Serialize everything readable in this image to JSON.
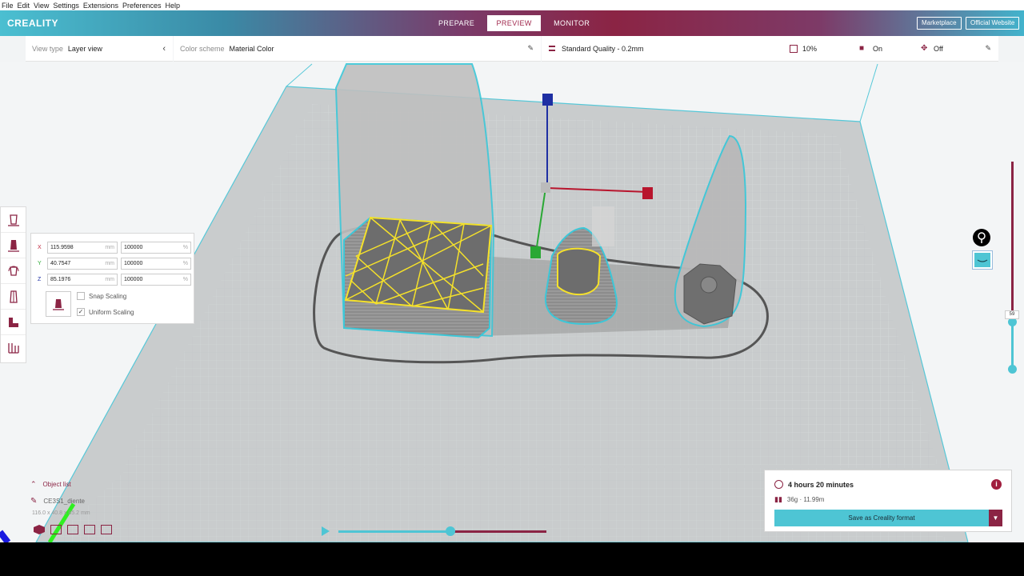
{
  "menu": [
    "File",
    "Edit",
    "View",
    "Settings",
    "Extensions",
    "Preferences",
    "Help"
  ],
  "header": {
    "logo": "CREALITY",
    "tabs": [
      {
        "label": "PREPARE",
        "active": false
      },
      {
        "label": "PREVIEW",
        "active": true
      },
      {
        "label": "MONITOR",
        "active": false
      }
    ],
    "marketplace": "Marketplace",
    "official_website": "Official Website"
  },
  "toolbar": {
    "view_type_label": "View type",
    "view_type_value": "Layer view",
    "color_scheme_label": "Color scheme",
    "color_scheme_value": "Material Color",
    "quality": "Standard Quality - 0.2mm",
    "infill": "10%",
    "support": "On",
    "adhesion": "Off"
  },
  "scale_panel": {
    "x_label": "X",
    "y_label": "Y",
    "z_label": "Z",
    "x_mm": "115.9598",
    "y_mm": "40.7547",
    "z_mm": "85.1976",
    "x_pct": "100000",
    "y_pct": "100000",
    "z_pct": "100000",
    "unit_mm": "mm",
    "unit_pct": "%",
    "snap_scaling": "Snap Scaling",
    "uniform_scaling": "Uniform Scaling",
    "snap_checked": false,
    "uniform_checked": true
  },
  "layer_slider": {
    "current_layer": "59",
    "level_fraction": 0.23
  },
  "object_list": {
    "header": "Object list",
    "object_name": "CE3S1_diente",
    "dims": "116.0 x 40.8 x 85.2 mm"
  },
  "playback": {
    "progress": 0.54
  },
  "print_info": {
    "time": "4 hours 20 minutes",
    "material": "36g · 11.99m",
    "save_button": "Save as Creality format"
  },
  "colors": {
    "accent": "#8b2444",
    "teal": "#4ec5d4",
    "yellow": "#f5e12a"
  }
}
